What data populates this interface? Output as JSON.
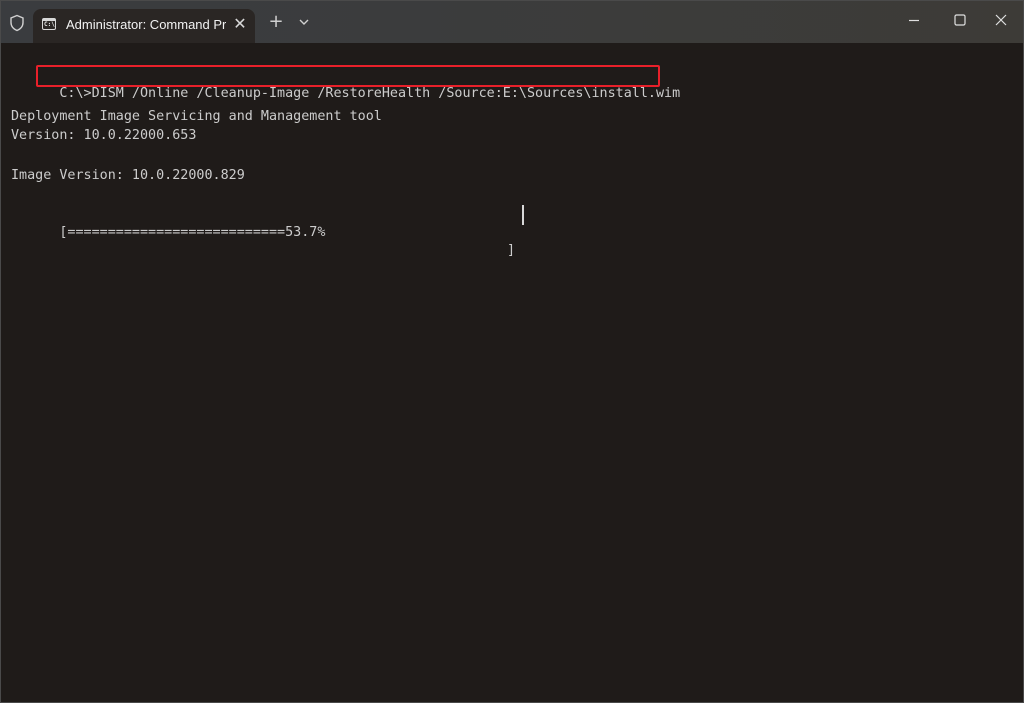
{
  "window": {
    "tab_title": "Administrator: Command Pro",
    "tab_icon": "cmd-icon",
    "shield_icon": "shield-icon",
    "new_tab_label": "+",
    "close_tab_label": "✕"
  },
  "terminal": {
    "prompt": "C:\\>",
    "command": "DISM /Online /Cleanup-Image /RestoreHealth /Source:E:\\Sources\\install.wim",
    "lines": [
      "Deployment Image Servicing and Management tool",
      "Version: 10.0.22000.653",
      "",
      "Image Version: 10.0.22000.829",
      ""
    ],
    "progress_text": "[===========================53.7%",
    "progress_end": "]",
    "progress_percent": 53.7
  },
  "colors": {
    "background": "#1f1b19",
    "text": "#cccccc",
    "highlight": "#e8202a"
  }
}
